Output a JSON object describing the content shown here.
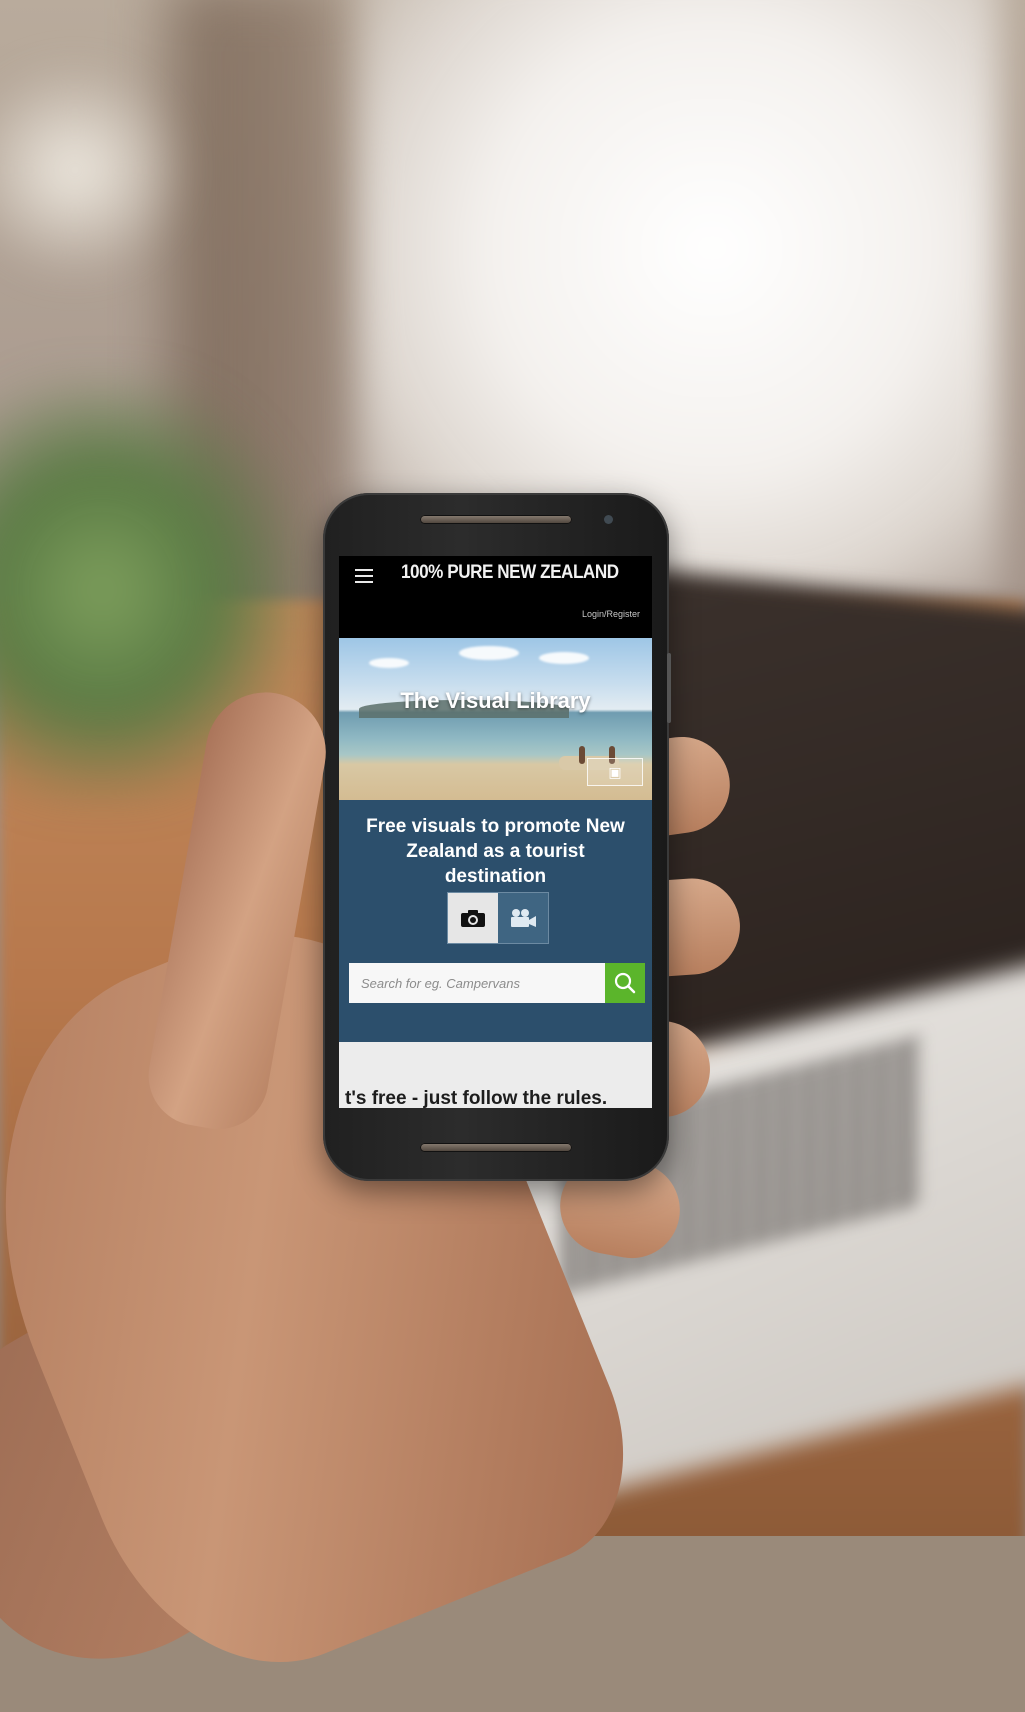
{
  "header": {
    "logo": "100% PURE NEW ZEALAND",
    "login_label": "Login/Register"
  },
  "hero": {
    "title": "The Visual Library"
  },
  "panel": {
    "tagline": "Free visuals to promote New Zealand as a tourist destination",
    "toggle": [
      {
        "icon": "camera-icon",
        "glyph": "📷",
        "active": true
      },
      {
        "icon": "video-camera-icon",
        "glyph": "🎥",
        "active": false
      }
    ],
    "search": {
      "placeholder": "Search for eg. Campervans"
    }
  },
  "rules": {
    "text": "t's free - just follow the rules."
  },
  "colors": {
    "panel_bg": "#2c4f6c",
    "search_button": "#5bb52b",
    "header_bg": "#000000"
  }
}
